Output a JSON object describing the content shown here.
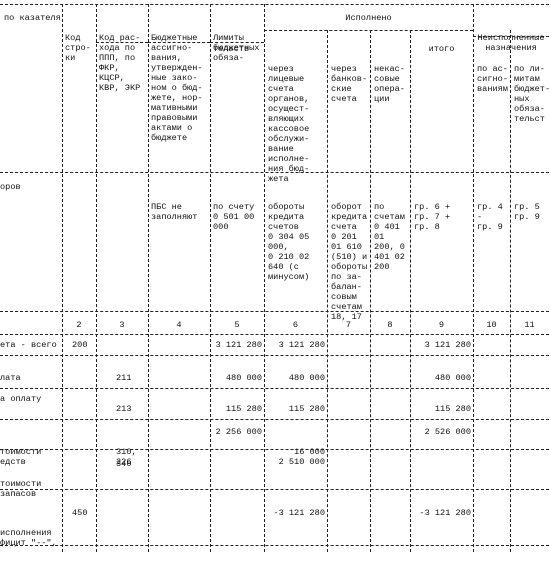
{
  "header_top": "--------------T----T-------T----------T-----------T---------------------------------------------------------T----------------",
  "header": {
    "col1": "по казателя",
    "col2": [
      "Код",
      "стро-",
      "ки"
    ],
    "col3": [
      "Код рас-",
      "хода по",
      "ППП, по",
      "ФКР,",
      "КЦСР,",
      "КВР, ЭКР"
    ],
    "col4": [
      "Бюджетные",
      "ассигно-",
      "вания,",
      "утвержден-",
      "ные зако-",
      "ном о бюд-",
      "жете, нор-",
      "мативными",
      "правовыми",
      "актами о",
      "бюджете"
    ],
    "col5": [
      "Лимиты",
      "бюджетных",
      "обяза-",
      "тельств"
    ],
    "executed": "Исполнено",
    "col6": [
      "через",
      "лицевые",
      "счета",
      "органов,",
      "осущест-",
      "вляющих",
      "кассовое",
      "обслужи-",
      "вание",
      "исполне-",
      "ния бюд-",
      "жета"
    ],
    "col7": [
      "через",
      "банков-",
      "ские",
      "счета"
    ],
    "col8": [
      "некас-",
      "совые",
      "опера-",
      "ции"
    ],
    "col9": "итого",
    "unexecuted": [
      "Неисполненные",
      "назначения"
    ],
    "col10": [
      "по ас-",
      "сигно-",
      "ваниям"
    ],
    "col11": [
      "по ли-",
      "митам",
      "бюджет-",
      "ных",
      "обяза-",
      "тельст"
    ]
  },
  "formula_row": {
    "col1": "оров",
    "col4": [
      "ПБС не",
      "заполняют"
    ],
    "col5": [
      "по счету",
      "0 501 00",
      "000"
    ],
    "col6": [
      "обороты",
      "кредита",
      "счетов",
      "0 304 05",
      "000,",
      "0 210 02",
      "640 (с",
      "минусом)"
    ],
    "col7": [
      "оборот",
      "кредита",
      "счета",
      "0 201",
      "01 610",
      "(510) и",
      "обороты",
      "по за-",
      "балан-",
      "совым",
      "счетам",
      "18, 17"
    ],
    "col8": [
      "по",
      "счетам",
      "0 401",
      "01",
      "200, 0",
      "401 02",
      "200"
    ],
    "col9": [
      "гр. 6 +",
      "гр. 7 +",
      "гр. 8"
    ],
    "col10": [
      "гр. 4",
      "-",
      "гр. 9"
    ],
    "col11": [
      "гр. 5",
      "гр. 9"
    ]
  },
  "column_numbers": [
    "2",
    "3",
    "4",
    "5",
    "6",
    "7",
    "8",
    "9",
    "10",
    "11"
  ],
  "rows": [
    {
      "name": [
        "ета - всего"
      ],
      "line": "200",
      "code": [],
      "col5": "3 121 280",
      "col6": "3 121 280",
      "col9": "3 121 280"
    },
    {
      "name": [
        "лата"
      ],
      "line": "",
      "code": [
        "211"
      ],
      "col5": "480 000",
      "col6": "480 000",
      "col9": "480 000"
    },
    {
      "name": [
        "а оплату",
        ""
      ],
      "line": "",
      "code": [
        "",
        "213"
      ],
      "col5": "115 280",
      "col6": "115 280",
      "col9": "115 280"
    },
    {
      "name": [
        "тоимости",
        "едств"
      ],
      "line": "",
      "code": [
        "310,",
        "226"
      ],
      "col5": "2 256 000",
      "col6": "16 000",
      "col6b": "2 510 000",
      "col9": "2 526 000"
    },
    {
      "name": [
        "тоимости",
        "запасов"
      ],
      "line": "",
      "code": [
        "340"
      ],
      "col5": "",
      "col6": "",
      "col9": ""
    },
    {
      "name": [
        "исполнения",
        "фицит \"--\","
      ],
      "line": "450",
      "code": [],
      "col5": "",
      "col6": "-3 121 280",
      "col9": "-3 121 280"
    }
  ]
}
